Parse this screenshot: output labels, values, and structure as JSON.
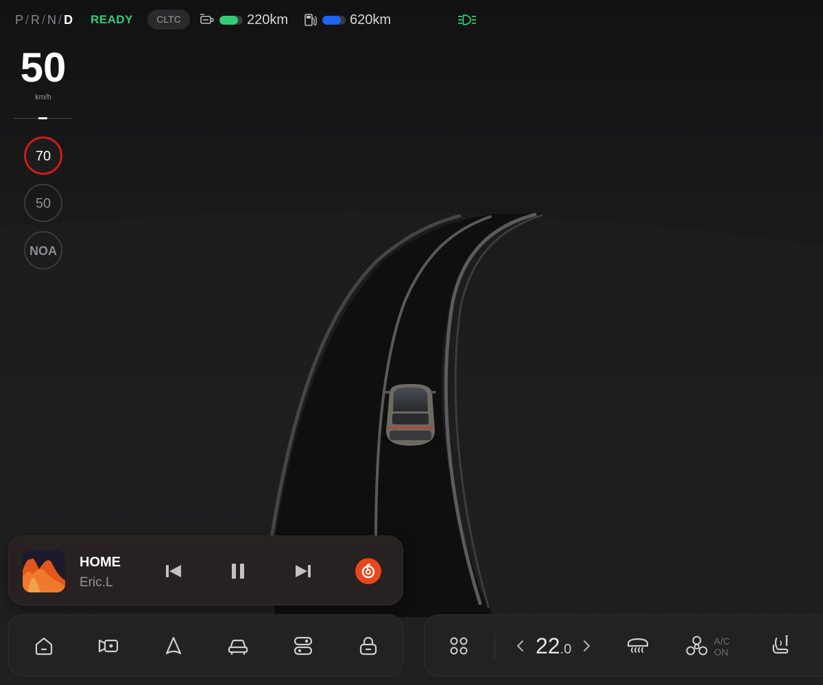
{
  "status": {
    "gears": [
      "P",
      "R",
      "N",
      "D"
    ],
    "gear_separator": "/",
    "active_gear": "D",
    "ready": "READY",
    "mode": "CLTC",
    "ev_range": "220km",
    "ev_level": 0.8,
    "fuel_range": "620km",
    "fuel_level": 0.8,
    "colors": {
      "ready": "#2fce73",
      "ev_bar": "#2fce73",
      "fuel_bar": "#1f64f4",
      "headlight": "#2fce73"
    },
    "icons": [
      "battery-plug-icon",
      "fuel-pump-icon",
      "low-beam-headlight-icon"
    ]
  },
  "speed": {
    "value": "50",
    "unit": "km/h"
  },
  "signs": {
    "speed_limit": "70",
    "cruise": "50",
    "noa": "NOA"
  },
  "media": {
    "title": "HOME",
    "artist": "Eric.L",
    "icons": [
      "previous-track-icon",
      "pause-icon",
      "next-track-icon",
      "netease-music-icon"
    ]
  },
  "dock_left": {
    "icons": [
      "home-icon",
      "dashcam-icon",
      "navigation-icon",
      "vehicle-icon",
      "controls-icon",
      "lock-icon"
    ]
  },
  "dock_right": {
    "icons": [
      "apps-grid-icon",
      "chevron-left-icon",
      "chevron-right-icon",
      "rear-defrost-icon",
      "fan-icon",
      "seat-heat-icon"
    ],
    "temperature_int": "22",
    "temperature_dec": ".0",
    "ac_label": "A/C",
    "ac_state": "ON"
  }
}
